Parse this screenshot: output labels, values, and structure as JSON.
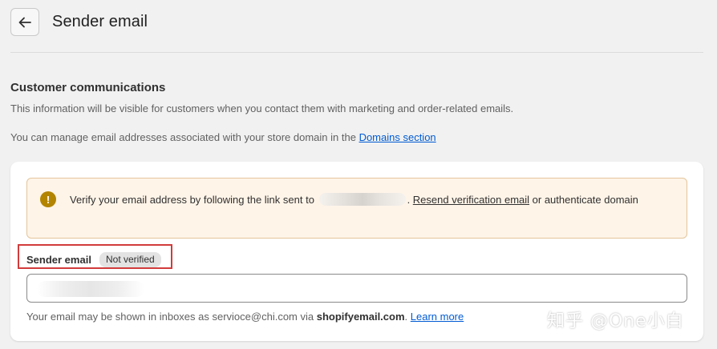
{
  "header": {
    "back_icon": "arrow-left-icon",
    "title": "Sender email"
  },
  "section": {
    "title": "Customer communications",
    "description": "This information will be visible for customers when you contact them with marketing and order-related emails.",
    "domains_prefix": "You can manage email addresses associated with your store domain in the ",
    "domains_link": "Domains section"
  },
  "banner": {
    "icon": "alert-circle-icon",
    "text_before": "Verify your email address by following the link sent to",
    "text_after_dot": ". ",
    "resend_link": "Resend verification email",
    "text_end": " or authenticate domain",
    "accent_color": "#b28400"
  },
  "field": {
    "label": "Sender email",
    "badge": "Not verified",
    "help_prefix": "Your email may be shown in inboxes as servioce@chi.com via ",
    "help_bold": "shopifyemail.com",
    "help_dot": ". ",
    "learn_more": "Learn more"
  },
  "watermark": "知乎 @One小白",
  "colors": {
    "link": "#005bd3",
    "highlight_box": "#d23b3b",
    "banner_bg": "#fff4e8"
  }
}
